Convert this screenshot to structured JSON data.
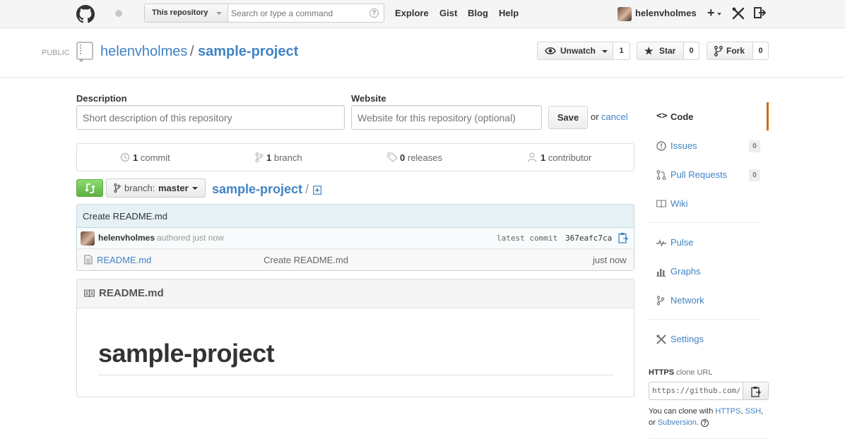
{
  "header": {
    "scope_label": "This repository",
    "search_placeholder": "Search or type a command",
    "search_help": "?",
    "nav": [
      "Explore",
      "Gist",
      "Blog",
      "Help"
    ],
    "username": "helenvholmes",
    "plus_label": "+"
  },
  "repo": {
    "visibility": "PUBLIC",
    "owner": "helenvholmes",
    "separator": "/",
    "name": "sample-project",
    "unwatch_label": "Unwatch",
    "watch_count": "1",
    "star_label": "Star",
    "star_count": "0",
    "fork_label": "Fork",
    "fork_count": "0"
  },
  "edit": {
    "description_label": "Description",
    "description_placeholder": "Short description of this repository",
    "website_label": "Website",
    "website_placeholder": "Website for this repository (optional)",
    "save_label": "Save",
    "or_text": "or",
    "cancel_label": "cancel"
  },
  "stats": {
    "commits_count": "1",
    "commits_label": "commit",
    "branches_count": "1",
    "branches_label": "branch",
    "releases_count": "0",
    "releases_label": "releases",
    "contributors_count": "1",
    "contributors_label": "contributor"
  },
  "filenav": {
    "branch_prefix": "branch:",
    "branch_name": "master",
    "breadcrumb_repo": "sample-project",
    "breadcrumb_sep": "/"
  },
  "commit": {
    "message": "Create README.md",
    "author": "helenvholmes",
    "authored_text": "authored just now",
    "latest_label": "latest commit",
    "sha": "367eafc7ca"
  },
  "files": [
    {
      "name": "README.md",
      "message": "Create README.md",
      "age": "just now"
    }
  ],
  "readme": {
    "filename": "README.md",
    "heading": "sample-project"
  },
  "sidebar": {
    "items": [
      {
        "label": "Code",
        "icon": "code-icon"
      },
      {
        "label": "Issues",
        "icon": "issue-icon",
        "count": "0"
      },
      {
        "label": "Pull Requests",
        "icon": "pull-request-icon",
        "count": "0"
      },
      {
        "label": "Wiki",
        "icon": "book-icon"
      },
      {
        "label": "Pulse",
        "icon": "pulse-icon"
      },
      {
        "label": "Graphs",
        "icon": "graph-icon"
      },
      {
        "label": "Network",
        "icon": "network-icon"
      },
      {
        "label": "Settings",
        "icon": "tools-icon"
      }
    ],
    "clone": {
      "protocol": "HTTPS",
      "suffix": "clone URL",
      "url": "https://github.com/helenvholmes/sample-project.git",
      "help_prefix": "You can clone with",
      "https": "HTTPS",
      "ssh": "SSH",
      "or_text": "or",
      "subversion": "Subversion"
    }
  },
  "colors": {
    "link": "#4183c4",
    "selected_tab_border": "#d26911",
    "compare_green": "#60b044"
  }
}
